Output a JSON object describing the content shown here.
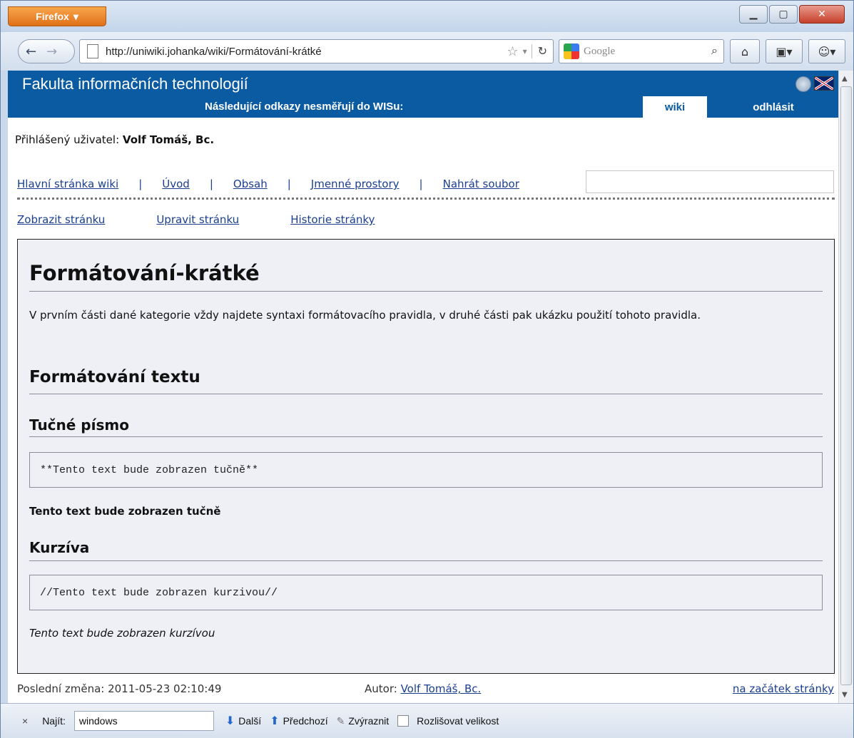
{
  "browser": {
    "menu_label": "Firefox",
    "url": "http://uniwiki.johanka/wiki/Formátování-krátké",
    "search_placeholder": "Google"
  },
  "site": {
    "title": "Fakulta informačních technologií",
    "notice": "Následující odkazy nesměřují do WISu:",
    "tab_wiki": "wiki",
    "tab_logout": "odhlásit"
  },
  "user": {
    "label": "Přihlášený uživatel:",
    "name": "Volf Tomáš, Bc."
  },
  "wiki_nav": [
    "Hlavní stránka wiki",
    "Úvod",
    "Obsah",
    "Jmenné prostory",
    "Nahrát soubor"
  ],
  "page_actions": [
    "Zobrazit stránku",
    "Upravit stránku",
    "Historie stránky"
  ],
  "content": {
    "title": "Formátování-krátké",
    "intro": "V prvním části dané kategorie vždy najdete syntaxi formátovacího pravidla, v druhé části pak ukázku použití tohoto pravidla.",
    "section": "Formátování textu",
    "bold_heading": "Tučné písmo",
    "bold_code": "**Tento text bude zobrazen tučně**",
    "bold_result": "Tento text bude zobrazen tučně",
    "italic_heading": "Kurzíva",
    "italic_code": "//Tento text bude zobrazen kurzivou//",
    "italic_result": "Tento text bude zobrazen kurzívou"
  },
  "footer": {
    "last_change": "Poslední změna: 2011-05-23 02:10:49",
    "author_label": "Autor:",
    "author": "Volf Tomáš, Bc.",
    "to_top": "na začátek stránky"
  },
  "findbar": {
    "close": "×",
    "label": "Najít:",
    "value": "windows",
    "next": "Další",
    "prev": "Předchozí",
    "highlight": "Zvýraznit",
    "match_case": "Rozlišovat velikost"
  }
}
